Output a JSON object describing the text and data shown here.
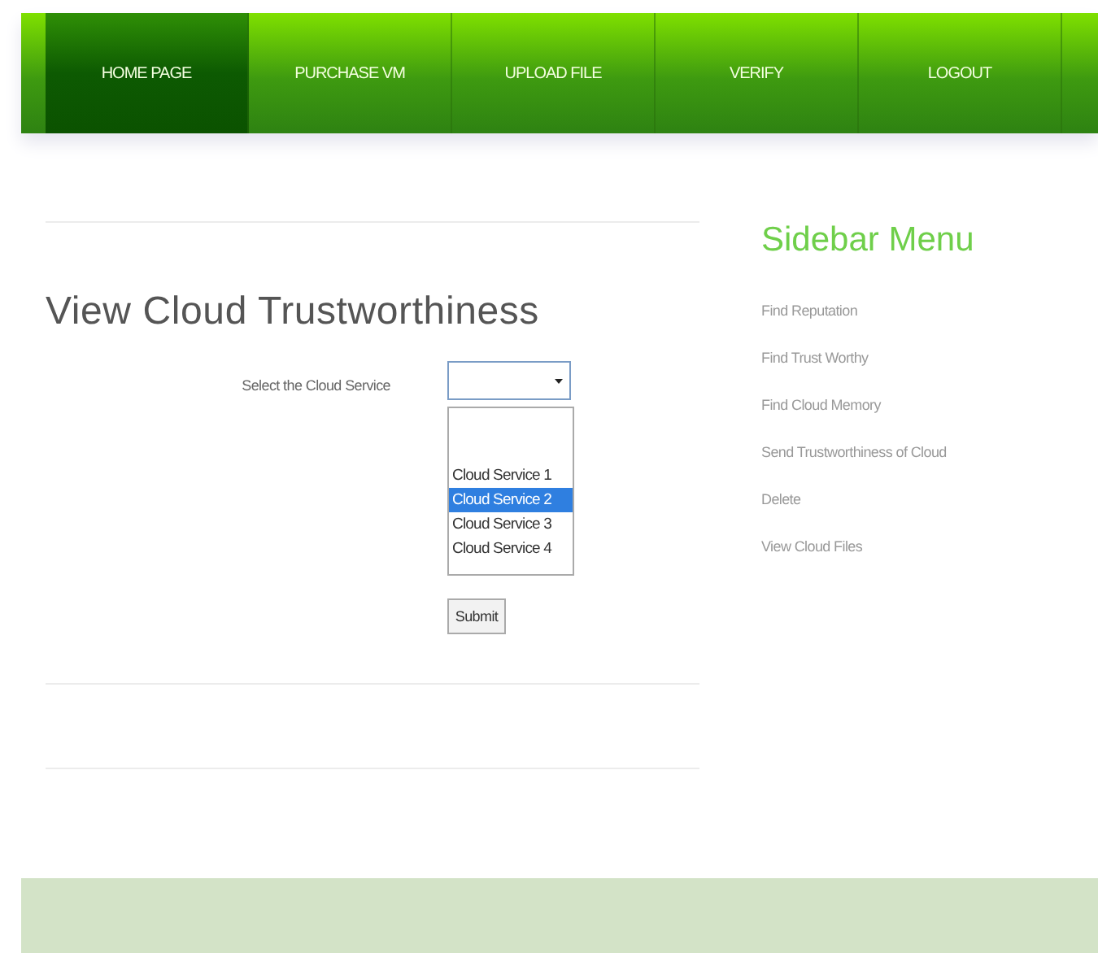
{
  "nav": [
    {
      "label": "HOME PAGE",
      "selected": true
    },
    {
      "label": "PURCHASE VM",
      "selected": false
    },
    {
      "label": "UPLOAD FILE",
      "selected": false
    },
    {
      "label": "VERIFY",
      "selected": false
    },
    {
      "label": "LOGOUT",
      "selected": false
    }
  ],
  "main": {
    "title": "View Cloud Trustworthiness",
    "field_label": "Select the Cloud Service",
    "options": [
      {
        "label": "Cloud Service 1",
        "selected": false
      },
      {
        "label": "Cloud Service 2",
        "selected": true
      },
      {
        "label": "Cloud Service 3",
        "selected": false
      },
      {
        "label": "Cloud Service 4",
        "selected": false
      }
    ],
    "submit": "Submit"
  },
  "sidebar": {
    "title": "Sidebar Menu",
    "items": [
      "Find Reputation",
      "Find Trust Worthy",
      "Find Cloud Memory",
      "Send Trustworthiness of Cloud",
      "Delete",
      "View Cloud Files"
    ]
  }
}
